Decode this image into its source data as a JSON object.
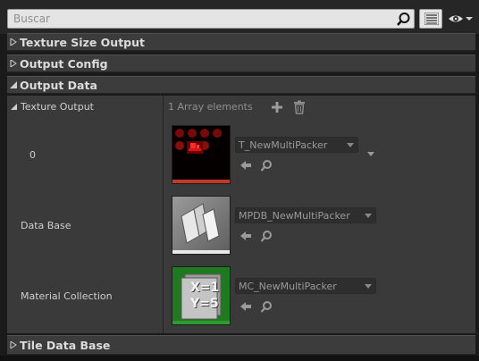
{
  "search": {
    "placeholder": "Buscar",
    "value": ""
  },
  "sections": [
    {
      "label": "Texture Size Output",
      "expanded": false
    },
    {
      "label": "Output Config",
      "expanded": false
    },
    {
      "label": "Output Data",
      "expanded": true
    },
    {
      "label": "Tile Data Base",
      "expanded": false
    }
  ],
  "output_data": {
    "texture_output": {
      "label": "Texture Output",
      "array_count": "1 Array elements",
      "elements": [
        {
          "index_label": "0",
          "asset": "T_NewMultiPacker"
        }
      ]
    },
    "data_base": {
      "label": "Data Base",
      "asset": "MPDB_NewMultiPacker"
    },
    "material_collection": {
      "label": "Material Collection",
      "asset": "MC_NewMultiPacker"
    }
  },
  "colors": {
    "texture_underline": "#c0392b",
    "database_underline": "#e8e8e8",
    "collection_underline": "#2f9a2f",
    "collection_bg": "#1f7a1f"
  },
  "icons": {
    "search": "magnifier-icon",
    "view_options": "list-view-icon",
    "visibility": "eye-icon",
    "add": "plus-icon",
    "delete": "trash-icon",
    "use_selected": "arrow-left-icon",
    "browse": "magnifier-icon"
  },
  "thumb_text": {
    "line1": "X=1",
    "line2": "Y=5"
  }
}
